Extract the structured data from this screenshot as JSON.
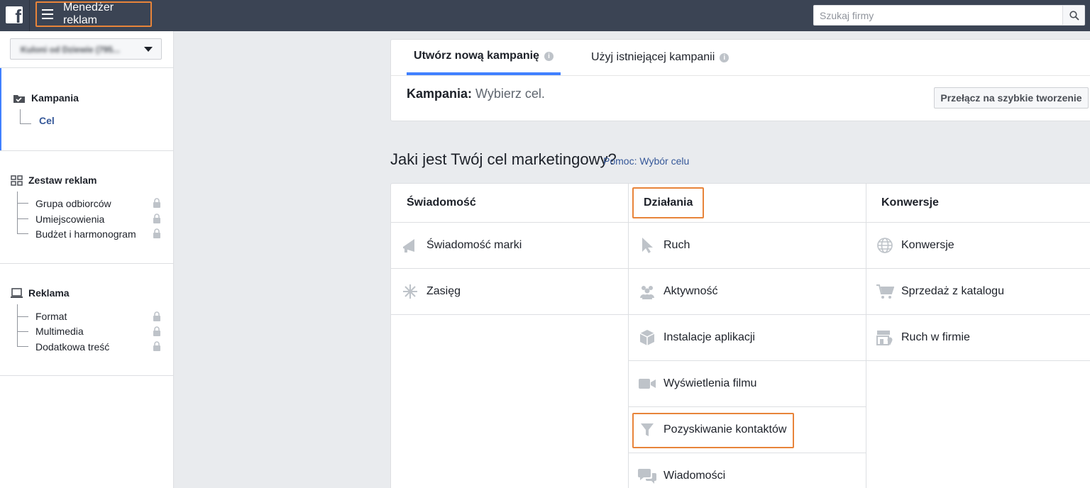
{
  "topbar": {
    "logo_letter": "f",
    "menu_label": "Menedżer reklam",
    "search_placeholder": "Szukaj firmy"
  },
  "sidebar": {
    "account_name": "Kuloni od Dziewie (795...",
    "campaign": {
      "title": "Kampania",
      "items": [
        {
          "label": "Cel"
        }
      ]
    },
    "adset": {
      "title": "Zestaw reklam",
      "items": [
        {
          "label": "Grupa odbiorców"
        },
        {
          "label": "Umiejscowienia"
        },
        {
          "label": "Budżet i harmonogram"
        }
      ]
    },
    "ad": {
      "title": "Reklama",
      "items": [
        {
          "label": "Format"
        },
        {
          "label": "Multimedia"
        },
        {
          "label": "Dodatkowa treść"
        }
      ]
    }
  },
  "tabs": [
    {
      "label": "Utwórz nową kampanię",
      "info": "i"
    },
    {
      "label": "Użyj istniejącej kampanii",
      "info": "i"
    }
  ],
  "campaign_line": {
    "label": "Kampania:",
    "value": "Wybierz cel."
  },
  "quick_button": "Przełącz na szybkie tworzenie",
  "question": "Jaki jest Twój cel marketingowy?",
  "help_link": "Pomoc: Wybór celu",
  "objectives": {
    "columns": [
      {
        "title": "Świadomość",
        "items": [
          {
            "label": "Świadomość marki",
            "icon": "megaphone-icon"
          },
          {
            "label": "Zasięg",
            "icon": "reach-icon"
          }
        ]
      },
      {
        "title": "Działania",
        "items": [
          {
            "label": "Ruch",
            "icon": "cursor-icon"
          },
          {
            "label": "Aktywność",
            "icon": "people-icon"
          },
          {
            "label": "Instalacje aplikacji",
            "icon": "box-icon"
          },
          {
            "label": "Wyświetlenia filmu",
            "icon": "video-camera-icon"
          },
          {
            "label": "Pozyskiwanie kontaktów",
            "icon": "funnel-icon"
          },
          {
            "label": "Wiadomości",
            "icon": "chat-bubbles-icon"
          }
        ]
      },
      {
        "title": "Konwersje",
        "items": [
          {
            "label": "Konwersje",
            "icon": "globe-icon"
          },
          {
            "label": "Sprzedaż z katalogu",
            "icon": "cart-icon"
          },
          {
            "label": "Ruch w firmie",
            "icon": "store-icon"
          }
        ]
      }
    ]
  },
  "colors": {
    "topbar": "#3b4454",
    "accent": "#4080ff",
    "highlight": "#e8843a",
    "link": "#365899"
  }
}
